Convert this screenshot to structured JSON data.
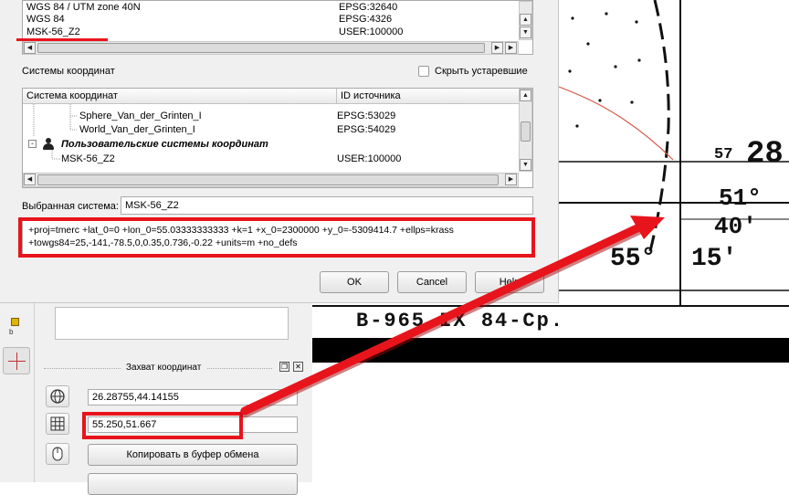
{
  "dialog": {
    "top_list": {
      "rows": [
        {
          "name": "WGS 84 / UTM zone 40N",
          "id": "EPSG:32640"
        },
        {
          "name": "WGS 84",
          "id": "EPSG:4326"
        },
        {
          "name": "MSK-56_Z2",
          "id": "USER:100000"
        }
      ]
    },
    "crs_section_label": "Системы координат",
    "hide_deprecated_label": "Скрыть устаревшие",
    "tree": {
      "col_system": "Система координат",
      "col_authority": "ID источника",
      "rows": [
        {
          "name": "Sphere_Van_der_Grinten_I",
          "id": "EPSG:53029"
        },
        {
          "name": "World_Van_der_Grinten_I",
          "id": "EPSG:54029"
        },
        {
          "name": "Пользовательские системы координат",
          "id": ""
        },
        {
          "name": "MSK-56_Z2",
          "id": "USER:100000"
        }
      ]
    },
    "selected_label": "Выбранная система:",
    "selected_value": "MSK-56_Z2",
    "proj_line1": "+proj=tmerc +lat_0=0 +lon_0=55.03333333333 +k=1 +x_0=2300000 +y_0=-5309414.7 +ellps=krass",
    "proj_line2": "+towgs84=25,-141,-78.5,0,0.35,0.736,-0.22 +units=m +no_defs",
    "ok_label": "OK",
    "cancel_label": "Cancel",
    "help_label": "Help"
  },
  "dock": {
    "title": "Захват координат",
    "coord_wgs": "26.28755,44.14155",
    "coord_project": "55.250,51.667",
    "copy_label": "Копировать в буфер обмена"
  },
  "map": {
    "label_57": "57",
    "label_28": "28",
    "label_51": "51°",
    "label_40": "40'",
    "label_55": "55°",
    "label_15": "15'",
    "label_bottom": "B-965 IX 84-Cp."
  },
  "colors": {
    "annotation_red": "#e8141c",
    "window_bg": "#f0f0f0"
  },
  "icons": [
    "expand-icon",
    "user-group-icon",
    "crosshair-icon",
    "globe-icon",
    "grid-icon",
    "mouse-icon",
    "float-icon",
    "close-icon"
  ]
}
